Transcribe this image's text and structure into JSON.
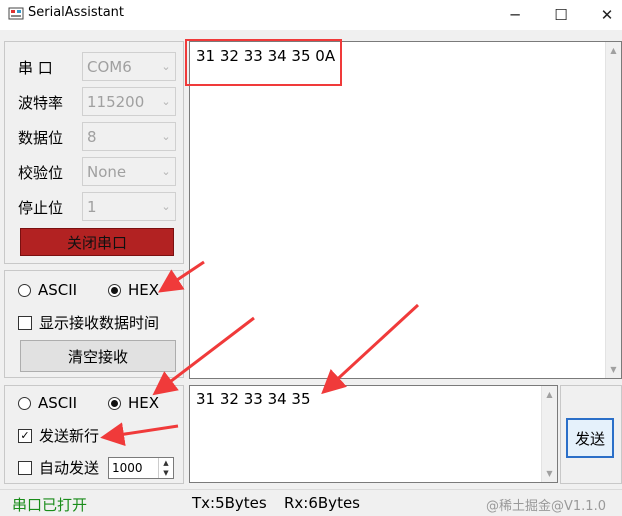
{
  "window": {
    "title": "SerialAssistant",
    "minimize": "─",
    "maximize": "☐",
    "close": "✕"
  },
  "settings": {
    "port": {
      "label": "串  口",
      "value": "COM6"
    },
    "baud": {
      "label": "波特率",
      "value": "115200"
    },
    "databits": {
      "label": "数据位",
      "value": "8"
    },
    "parity": {
      "label": "校验位",
      "value": "None"
    },
    "stopbits": {
      "label": "停止位",
      "value": "1"
    },
    "close_port_label": "关闭串口"
  },
  "receive": {
    "ascii_label": "ASCII",
    "hex_label": "HEX",
    "mode": "HEX",
    "show_time_label": "显示接收数据时间",
    "show_time_checked": false,
    "clear_label": "清空接收",
    "content": "31 32 33 34 35 0A"
  },
  "send": {
    "ascii_label": "ASCII",
    "hex_label": "HEX",
    "mode": "HEX",
    "newline_label": "发送新行",
    "newline_checked": true,
    "auto_label": "自动发送",
    "auto_checked": false,
    "interval": "1000",
    "content": "31 32 33  34 35",
    "send_label": "发送"
  },
  "status": {
    "port_status": "串口已打开",
    "tx": "Tx:5Bytes",
    "rx": "Rx:6Bytes",
    "watermark": "@稀土掘金@V1.1.0"
  },
  "colors": {
    "annotation_red": "#f03a3a",
    "status_green": "#1a8c1a",
    "close_button": "#b22222",
    "send_button_border": "#2b6fc8"
  }
}
